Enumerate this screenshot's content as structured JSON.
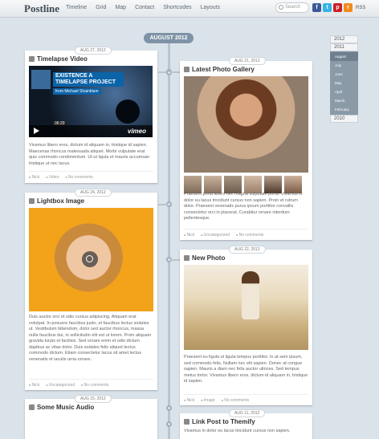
{
  "site": {
    "title": "Postline"
  },
  "nav": [
    "Timeline",
    "Grid",
    "Map",
    "Contact",
    "Shortcodes",
    "Layouts"
  ],
  "search": {
    "placeholder": "Search"
  },
  "social": [
    {
      "icon": "facebook-icon",
      "glyph": "f",
      "color": "#3b5998"
    },
    {
      "icon": "twitter-icon",
      "glyph": "t",
      "color": "#33b5e5"
    },
    {
      "icon": "pinterest-icon",
      "glyph": "p",
      "color": "#cb2027"
    },
    {
      "icon": "rss-icon",
      "glyph": "r",
      "color": "#f28a1e"
    }
  ],
  "rss_label": "RSS",
  "timeline": {
    "month": "AUGUST 2012"
  },
  "archive": {
    "years": [
      "2012",
      "2011",
      "2010"
    ],
    "months": [
      "August",
      "July",
      "June",
      "May",
      "April",
      "March",
      "February"
    ]
  },
  "posts": {
    "timelapse": {
      "date": "AUG 27, 2012",
      "title": "Timelapse Video",
      "video": {
        "title": "EXISTENCE A TIMELAPSE PROJECT",
        "from": "from Michael Shainblum",
        "time": "06:29",
        "brand": "vimeo"
      },
      "excerpt": "Vivamus libero eros, dictum id aliquam in, tristique id sapien. Maecenas rhoncus malesuada aliquet. Morbi vulputate erat quis commodo condimentum. Ut ut ligula et mauris accumsan tristique ut nec lacus.",
      "author": "Nick",
      "category": "Video",
      "comments": "No comments"
    },
    "gallery": {
      "date": "AUG 21, 2012",
      "title": "Latest Photo Gallery",
      "excerpt": "Praesent porta libero nec magna vulputate porta. Vivamus in dolor eu lacus tincidunt cursus non sapien. Proin et rutrum dolor. Praesent venenatis purus ipsum porttitor convallis consectetur orci in placerat. Curabitur ornare interdum pellentesque.",
      "author": "Nick",
      "category": "Uncategorized",
      "comments": "No comments"
    },
    "lightbox": {
      "date": "AUG 24, 2012",
      "title": "Lightbox Image",
      "excerpt": "Duis auctor orci et odio cursus adipiscing. Aliquam erat volutpat. In posuere faucibus justo, et faucibus lectus sodales ut. Vestibulum bibendum, dolor sed auctor rhoncus, massa nulla faucibus dui, in sollicitudin elit est ut lorem. Proin aliquam gravida turpis et facilisis. Sed ornare enim et odio dictum dapibus ac vitae dolor. Duis sodales felis aliquet lectus commodo dictum. Etiam consectetur lacus sit amet lectus venenatis et iaculis urna ornare.",
      "author": "Nick",
      "category": "Uncategorized",
      "comments": "No comments"
    },
    "newphoto": {
      "date": "AUG 22, 2012",
      "title": "New Photo",
      "excerpt": "Praesent eu ligula ut ligula tempus porttitor. In at sem ipsum, sed commodo felis. Nullam nec elit sapien. Donec at congue sapien. Mauris a diam nec felis auctor ultrices. Sed tempus metus tortor. Vivamus libero eros, dictum id aliquam in, tristique id sapien.",
      "author": "Nick",
      "category": "Image",
      "comments": "No comments"
    },
    "audio": {
      "date": "AUG 15, 2012",
      "title": "Some Music Audio"
    },
    "link": {
      "date": "AUG 11, 2012",
      "title": "Link Post to Themify",
      "excerpt": "Vivamus in dolor eu lacus tincidunt cursus non sapien."
    }
  },
  "colors": {
    "spine": "#b9c4ce",
    "month_pill": "#7f93a6",
    "background": "#dbe3ea"
  }
}
